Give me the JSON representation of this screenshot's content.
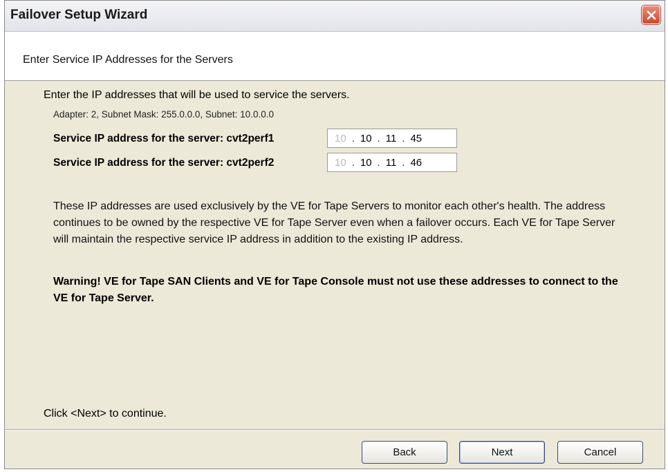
{
  "window": {
    "title": "Failover Setup Wizard"
  },
  "header": {
    "title": "Enter Service IP Addresses for the Servers"
  },
  "content": {
    "intro": "Enter the IP addresses that will be used to service the servers.",
    "adapter_info": "Adapter: 2, Subnet Mask: 255.0.0.0, Subnet: 10.0.0.0",
    "servers": [
      {
        "label": "Service IP address for the server: cvt2perf1",
        "ip": [
          "10",
          "10",
          "11",
          "45"
        ]
      },
      {
        "label": "Service IP address for the server: cvt2perf2",
        "ip": [
          "10",
          "10",
          "11",
          "46"
        ]
      }
    ],
    "description": "These IP addresses are used exclusively by the VE for Tape Servers to monitor each other's health. The address continues to be owned by the respective VE for Tape Server even when a failover occurs. Each VE for Tape Server will maintain the respective service IP address in addition to the existing IP address.",
    "warning": "Warning! VE for Tape SAN Clients and VE for Tape Console must not use these addresses to connect to the VE for Tape Server.",
    "hint": "Click <Next> to continue."
  },
  "buttons": {
    "back": "Back",
    "next": "Next",
    "cancel": "Cancel"
  },
  "icons": {
    "close": "close-icon"
  },
  "colors": {
    "dialog_bg": "#ece9d8",
    "close_button": "#c74b34"
  }
}
